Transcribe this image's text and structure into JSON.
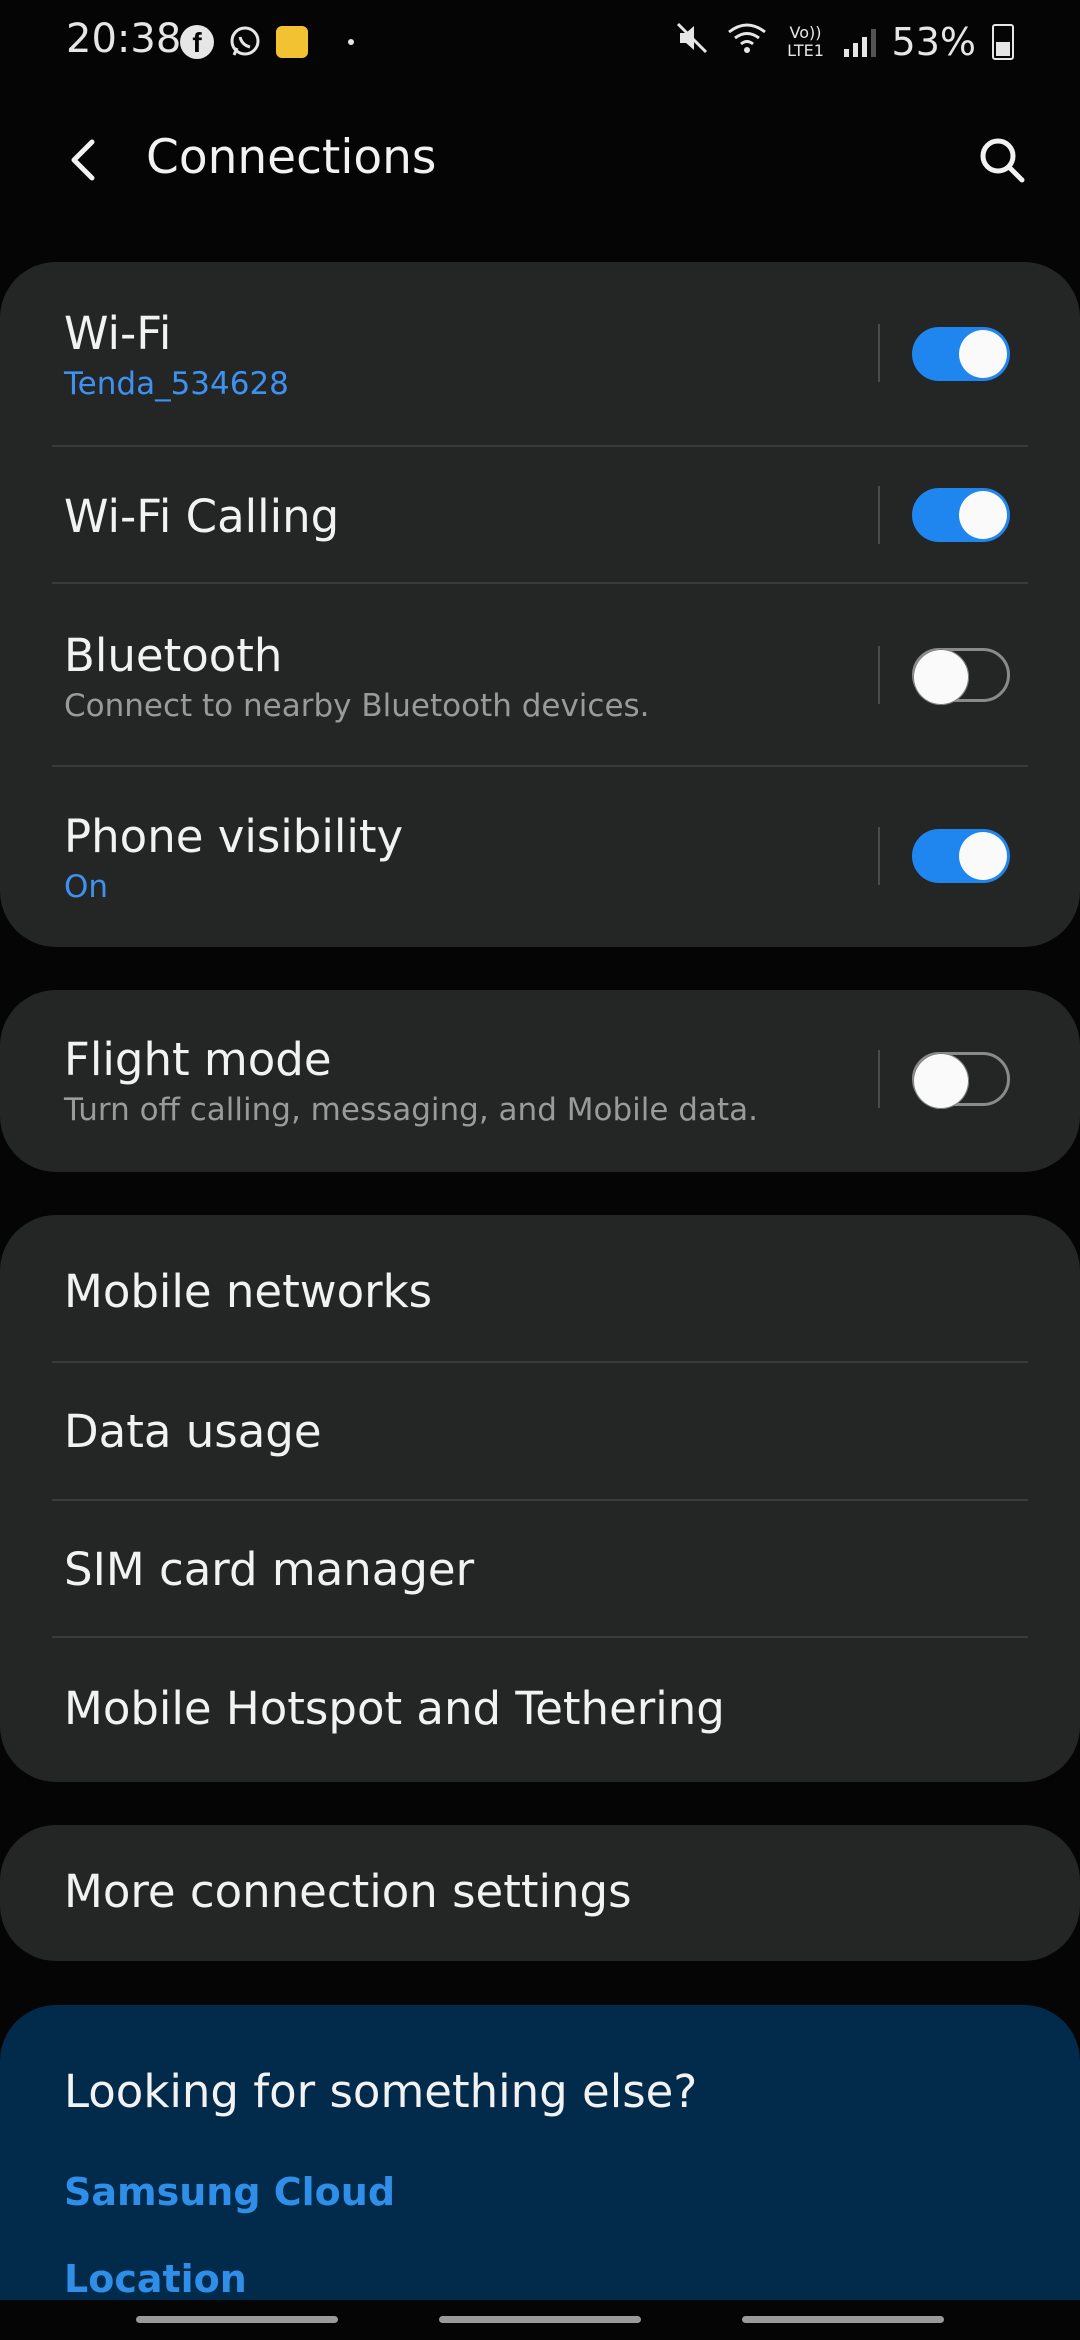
{
  "status_bar": {
    "time": "20:38",
    "notification_icons": [
      "facebook-icon",
      "whatsapp-icon",
      "app-icon"
    ],
    "network": "Vo)) LTE1",
    "battery": "53%"
  },
  "app_bar": {
    "title": "Connections",
    "back_icon": "back-arrow-icon",
    "search_icon": "search-icon"
  },
  "group1": [
    {
      "title": "Wi-Fi",
      "subtitle": "Tenda_534628",
      "subtitle_style": "blue",
      "toggle": true
    },
    {
      "title": "Wi-Fi Calling",
      "subtitle": "",
      "subtitle_style": "",
      "toggle": true
    },
    {
      "title": "Bluetooth",
      "subtitle": "Connect to nearby Bluetooth devices.",
      "subtitle_style": "grey",
      "toggle": false
    },
    {
      "title": "Phone visibility",
      "subtitle": "On",
      "subtitle_style": "blue",
      "toggle": true
    }
  ],
  "group2": [
    {
      "title": "Flight mode",
      "subtitle": "Turn off calling, messaging, and Mobile data.",
      "subtitle_style": "grey",
      "toggle": false
    }
  ],
  "group3": [
    {
      "title": "Mobile networks"
    },
    {
      "title": "Data usage"
    },
    {
      "title": "SIM card manager"
    },
    {
      "title": "Mobile Hotspot and Tethering"
    }
  ],
  "group4": [
    {
      "title": "More connection settings"
    }
  ],
  "suggestions": {
    "heading": "Looking for something else?",
    "links": [
      "Samsung Cloud",
      "Location"
    ]
  },
  "colors": {
    "background": "#050505",
    "card": "#242626",
    "accent": "#1f86ef",
    "suggestion_bg": "#022a4a"
  }
}
